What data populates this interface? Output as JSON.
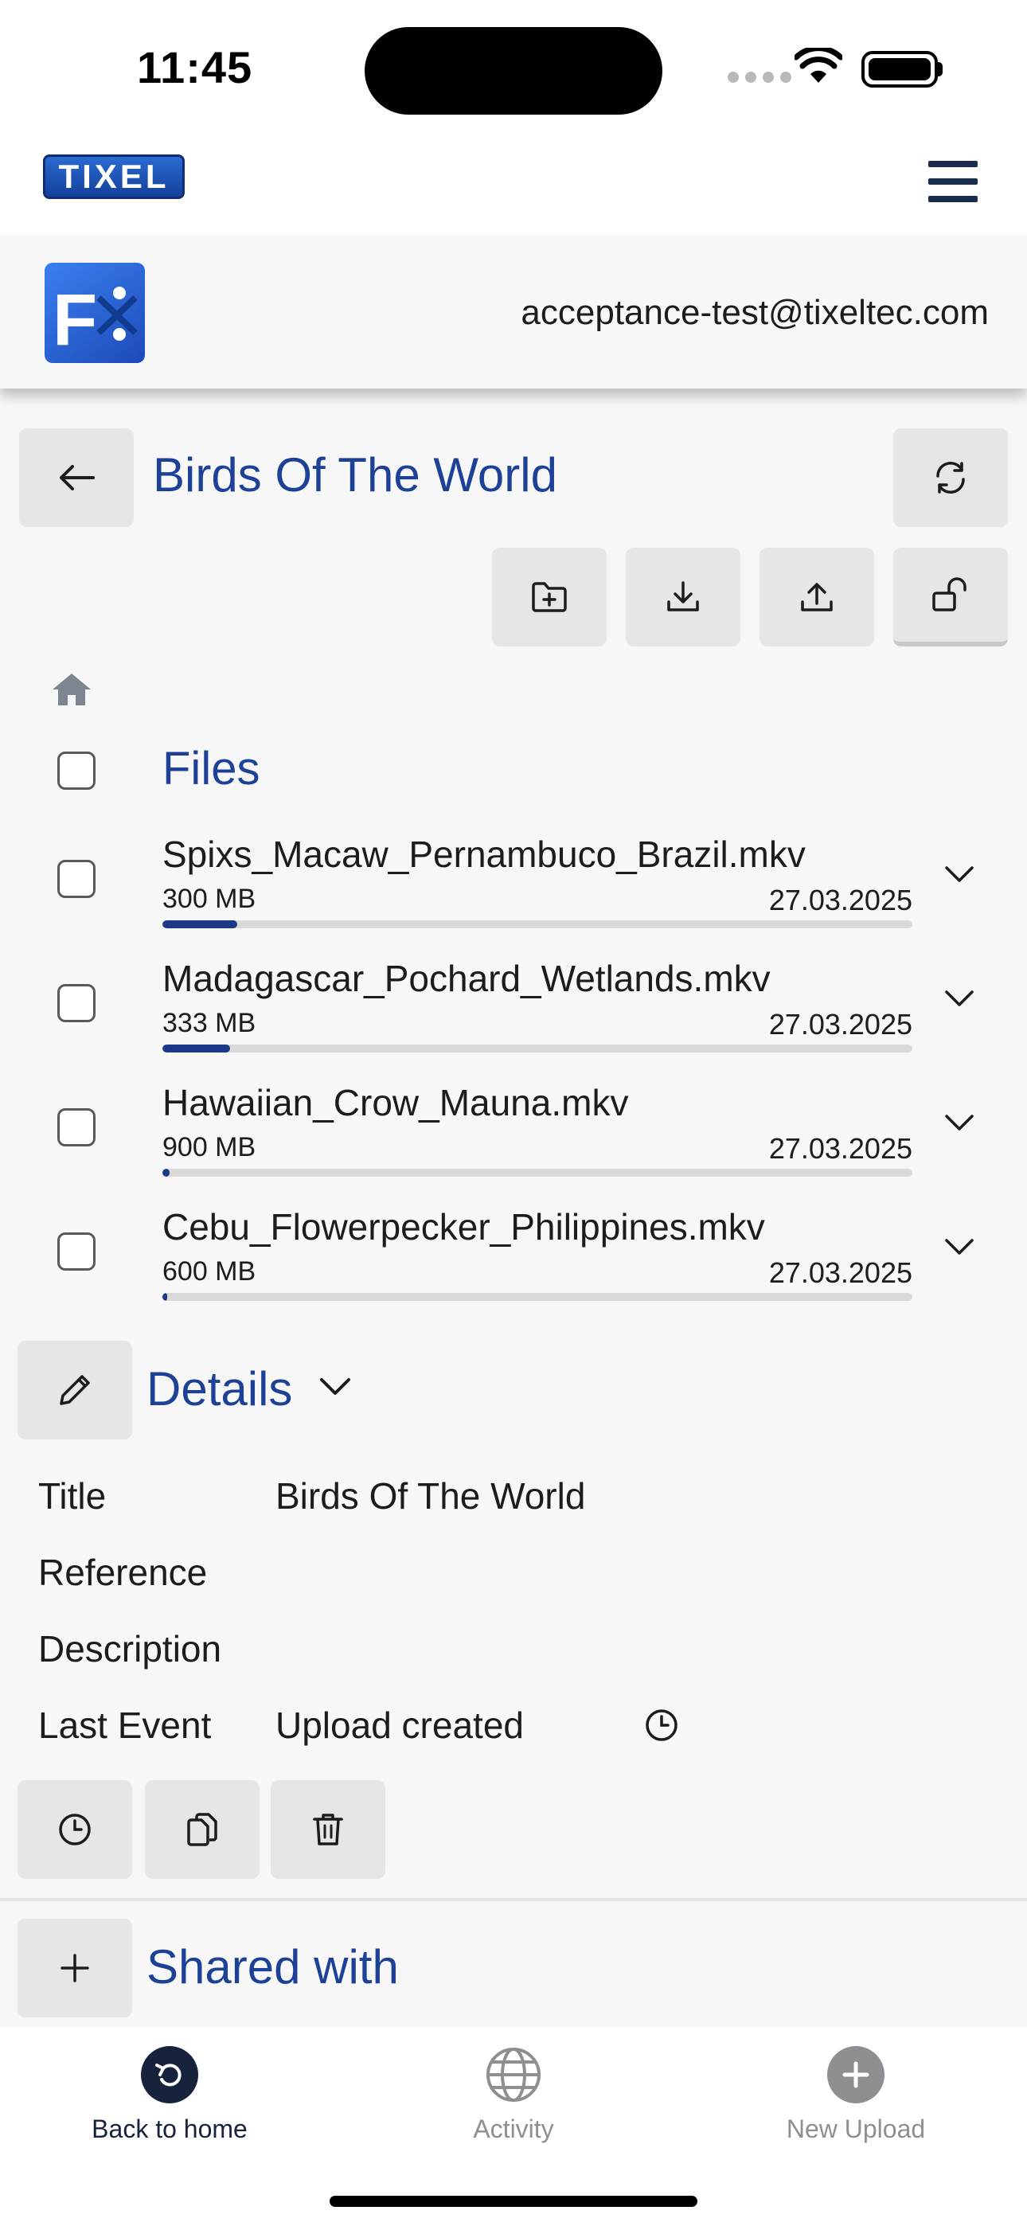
{
  "status_bar": {
    "time": "11:45"
  },
  "app": {
    "brand": "TIXEL"
  },
  "user": {
    "email": "acceptance-test@tixeltec.com"
  },
  "page": {
    "title": "Birds Of The World"
  },
  "files": {
    "title": "Files",
    "items": [
      {
        "name": "Spixs_Macaw_Pernambuco_Brazil.mkv",
        "size": "300 MB",
        "date": "27.03.2025",
        "progress": 0.1
      },
      {
        "name": "Madagascar_Pochard_Wetlands.mkv",
        "size": "333 MB",
        "date": "27.03.2025",
        "progress": 0.09
      },
      {
        "name": "Hawaiian_Crow_Mauna.mkv",
        "size": "900 MB",
        "date": "27.03.2025",
        "progress": 0.01
      },
      {
        "name": "Cebu_Flowerpecker_Philippines.mkv",
        "size": "600 MB",
        "date": "27.03.2025",
        "progress": 0.005
      }
    ]
  },
  "details": {
    "title": "Details",
    "rows": [
      {
        "label": "Title",
        "value": "Birds Of The World"
      },
      {
        "label": "Reference",
        "value": ""
      },
      {
        "label": "Description",
        "value": ""
      },
      {
        "label": "Last Event",
        "value": "Upload created"
      }
    ]
  },
  "shared": {
    "title": "Shared with"
  },
  "tabbar": {
    "items": [
      {
        "label": "Back to home",
        "icon": "back-arrow-icon",
        "active": true
      },
      {
        "label": "Activity",
        "icon": "globe-icon",
        "active": false
      },
      {
        "label": "New Upload",
        "icon": "plus-circle-icon",
        "active": false
      }
    ]
  },
  "colors": {
    "accent": "#1d4196",
    "progress": "#1d3a8a",
    "button_bg": "#e6e6e6",
    "tab_active": "#17233d"
  }
}
